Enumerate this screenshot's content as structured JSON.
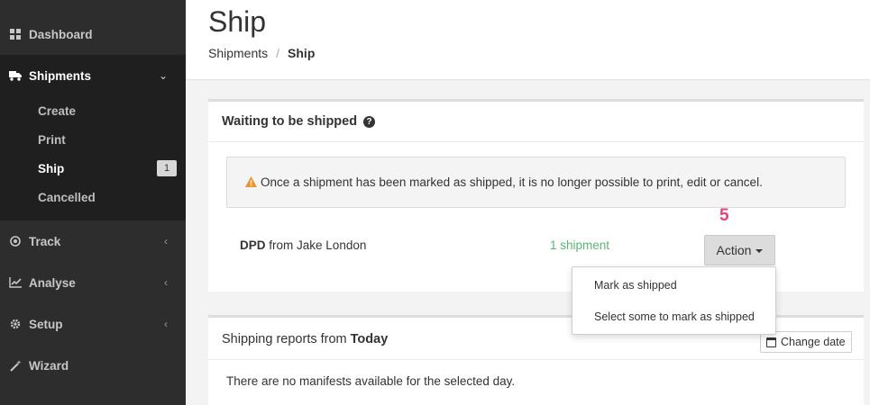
{
  "sidebar": {
    "dashboard": {
      "label": "Dashboard",
      "icon": "grid-icon"
    },
    "shipments": {
      "label": "Shipments",
      "icon": "truck-icon"
    },
    "sub": {
      "create": "Create",
      "print": "Print",
      "ship": "Ship",
      "ship_badge": "1",
      "cancelled": "Cancelled"
    },
    "track": {
      "label": "Track",
      "icon": "target-icon"
    },
    "analyse": {
      "label": "Analyse",
      "icon": "chart-icon"
    },
    "setup": {
      "label": "Setup",
      "icon": "gear-icon"
    },
    "wizard": {
      "label": "Wizard",
      "icon": "wand-icon"
    }
  },
  "header": {
    "title": "Ship",
    "breadcrumb": {
      "parent": "Shipments",
      "current": "Ship"
    }
  },
  "waiting_panel": {
    "title": "Waiting to be shipped",
    "alert": "Once a shipment has been marked as shipped, it is no longer possible to print, edit or cancel.",
    "carrier_name": "DPD",
    "carrier_from": "from Jake London",
    "count": "1 shipment",
    "step": "5",
    "action_label": "Action"
  },
  "dropdown": {
    "items": [
      "Mark as shipped",
      "Select some to mark as shipped"
    ]
  },
  "reports_panel": {
    "title_prefix": "Shipping reports from",
    "title_day": "Today",
    "change_date": "Change date",
    "empty": "There are no manifests available for the selected day."
  },
  "colors": {
    "sidebar_bg": "#2d2d2d",
    "sidebar_active": "#1f1f1f",
    "success_text": "#5cb377",
    "step_marker": "#e0457b",
    "warning": "#e8962f"
  }
}
